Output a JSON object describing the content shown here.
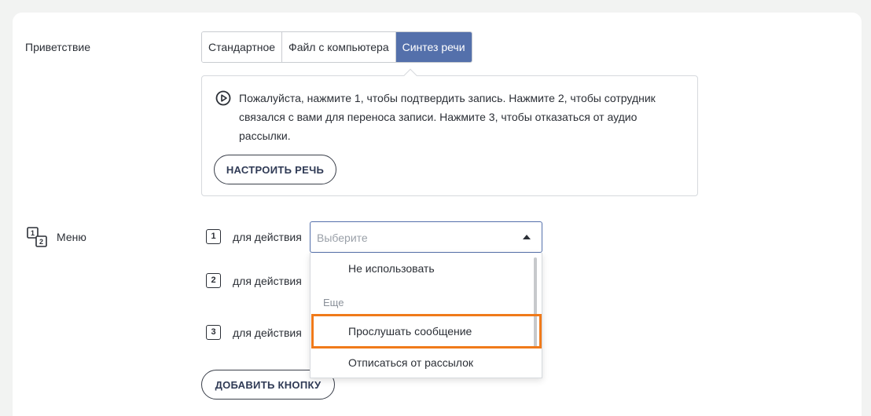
{
  "greeting": {
    "label": "Приветствие",
    "tabs": [
      {
        "label": "Стандартное",
        "active": false
      },
      {
        "label": "Файл с компьютера",
        "active": false
      },
      {
        "label": "Синтез речи",
        "active": true
      }
    ],
    "speech_text": "Пожалуйста, нажмите 1, чтобы подтвердить запись. Нажмите 2, чтобы сотрудник связался с вами для переноса записи. Нажмите 3, чтобы отказаться от аудио рассылки.",
    "configure_button": "НАСТРОИТЬ РЕЧЬ"
  },
  "menu": {
    "label": "Меню",
    "icon_digits": [
      "1",
      "2"
    ],
    "keys": [
      {
        "number": "1",
        "action_label": "для действия"
      },
      {
        "number": "2",
        "action_label": "для действия"
      },
      {
        "number": "3",
        "action_label": "для действия"
      }
    ],
    "select": {
      "placeholder": "Выберите",
      "options": [
        "Не использовать"
      ],
      "group_label": "Еще",
      "group_options": [
        "Прослушать сообщение",
        "Отписаться от рассылок"
      ],
      "highlighted_option": "Прослушать сообщение"
    },
    "add_button": "ДОБАВИТЬ КНОПКУ"
  },
  "colors": {
    "active_tab": "#5470ab",
    "highlight": "#f07a1a"
  }
}
